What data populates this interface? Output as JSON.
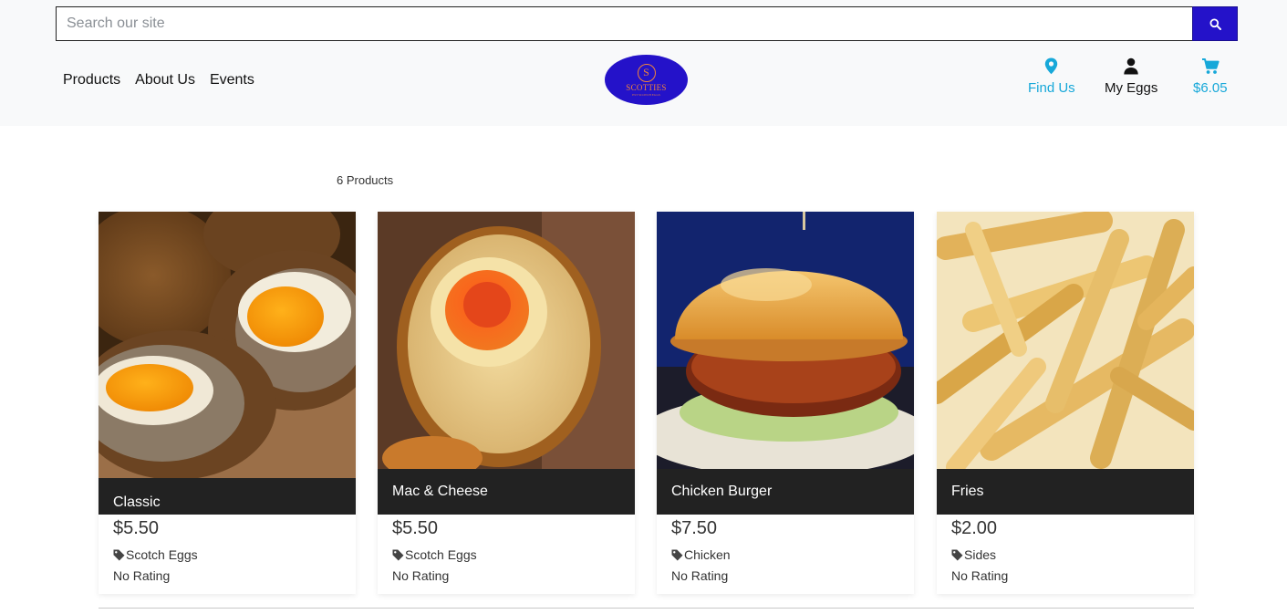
{
  "search": {
    "placeholder": "Search our site"
  },
  "nav": {
    "links": [
      "Products",
      "About Us",
      "Events"
    ],
    "find_us": "Find Us",
    "my_eggs": "My Eggs",
    "cart_total": "$6.05"
  },
  "logo": {
    "letter": "S",
    "name": "SCOTTIES",
    "tagline": "EST SCOTCH EGGS"
  },
  "listing": {
    "count_label": "6 Products"
  },
  "products": [
    {
      "name": "Classic",
      "price": "$5.50",
      "category": "Scotch Eggs",
      "rating": "No Rating"
    },
    {
      "name": "Mac & Cheese",
      "price": "$5.50",
      "category": "Scotch Eggs",
      "rating": "No Rating"
    },
    {
      "name": "Chicken Burger",
      "price": "$7.50",
      "category": "Chicken",
      "rating": "No Rating"
    },
    {
      "name": "Fries",
      "price": "$2.00",
      "category": "Sides",
      "rating": "No Rating"
    }
  ],
  "colors": {
    "brand": "#2412c9",
    "accent": "#17a8d9",
    "logo_text": "#f0843b",
    "card_title_bg": "#222222"
  },
  "icons": {
    "search": "search-icon",
    "location": "location-pin-icon",
    "user": "user-icon",
    "cart": "cart-icon",
    "tag": "tag-icon"
  }
}
